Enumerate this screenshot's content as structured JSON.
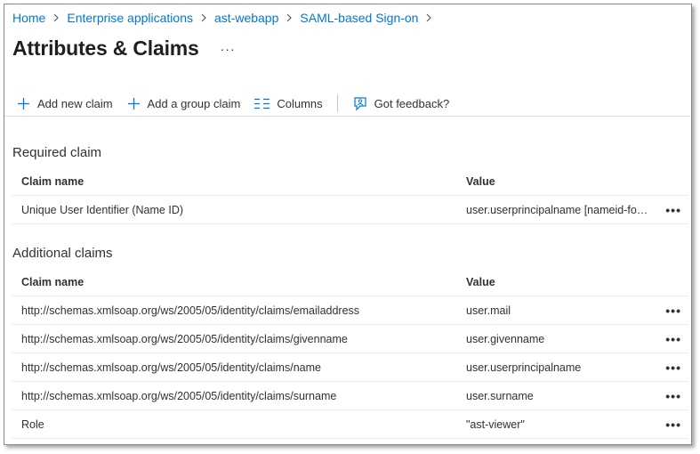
{
  "breadcrumb": {
    "items": [
      "Home",
      "Enterprise applications",
      "ast-webapp",
      "SAML-based Sign-on"
    ]
  },
  "page": {
    "title": "Attributes & Claims",
    "more": "···"
  },
  "toolbar": {
    "add_claim": "Add new claim",
    "add_group_claim": "Add a group claim",
    "columns": "Columns",
    "feedback": "Got feedback?"
  },
  "required": {
    "title": "Required claim",
    "headers": {
      "name": "Claim name",
      "value": "Value"
    },
    "rows": [
      {
        "name": "Unique User Identifier (Name ID)",
        "value": "user.userprincipalname [nameid-format:emailAddress]"
      }
    ]
  },
  "additional": {
    "title": "Additional claims",
    "headers": {
      "name": "Claim name",
      "value": "Value"
    },
    "rows": [
      {
        "name": "http://schemas.xmlsoap.org/ws/2005/05/identity/claims/emailaddress",
        "value": "user.mail"
      },
      {
        "name": "http://schemas.xmlsoap.org/ws/2005/05/identity/claims/givenname",
        "value": "user.givenname"
      },
      {
        "name": "http://schemas.xmlsoap.org/ws/2005/05/identity/claims/name",
        "value": "user.userprincipalname"
      },
      {
        "name": "http://schemas.xmlsoap.org/ws/2005/05/identity/claims/surname",
        "value": "user.surname"
      },
      {
        "name": "Role",
        "value": "\"ast-viewer\""
      }
    ]
  },
  "row_menu": "•••",
  "colors": {
    "link": "#0078d4",
    "text": "#323130",
    "border": "#edebe9"
  }
}
